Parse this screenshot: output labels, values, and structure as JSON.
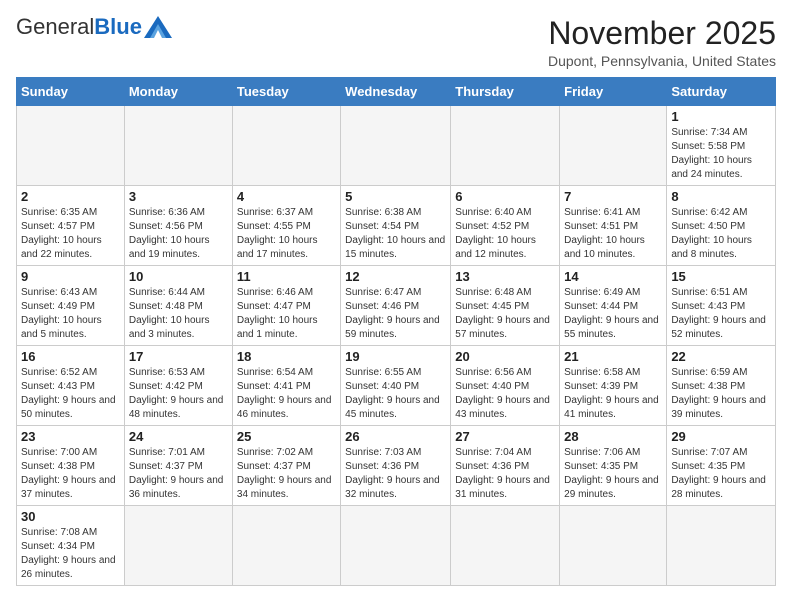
{
  "header": {
    "logo_general": "General",
    "logo_blue": "Blue",
    "logo_sub": "BLUE",
    "month_title": "November 2025",
    "location": "Dupont, Pennsylvania, United States"
  },
  "days_of_week": [
    "Sunday",
    "Monday",
    "Tuesday",
    "Wednesday",
    "Thursday",
    "Friday",
    "Saturday"
  ],
  "weeks": [
    [
      {
        "day": "",
        "info": ""
      },
      {
        "day": "",
        "info": ""
      },
      {
        "day": "",
        "info": ""
      },
      {
        "day": "",
        "info": ""
      },
      {
        "day": "",
        "info": ""
      },
      {
        "day": "",
        "info": ""
      },
      {
        "day": "1",
        "info": "Sunrise: 7:34 AM\nSunset: 5:58 PM\nDaylight: 10 hours and 24 minutes."
      }
    ],
    [
      {
        "day": "2",
        "info": "Sunrise: 6:35 AM\nSunset: 4:57 PM\nDaylight: 10 hours and 22 minutes."
      },
      {
        "day": "3",
        "info": "Sunrise: 6:36 AM\nSunset: 4:56 PM\nDaylight: 10 hours and 19 minutes."
      },
      {
        "day": "4",
        "info": "Sunrise: 6:37 AM\nSunset: 4:55 PM\nDaylight: 10 hours and 17 minutes."
      },
      {
        "day": "5",
        "info": "Sunrise: 6:38 AM\nSunset: 4:54 PM\nDaylight: 10 hours and 15 minutes."
      },
      {
        "day": "6",
        "info": "Sunrise: 6:40 AM\nSunset: 4:52 PM\nDaylight: 10 hours and 12 minutes."
      },
      {
        "day": "7",
        "info": "Sunrise: 6:41 AM\nSunset: 4:51 PM\nDaylight: 10 hours and 10 minutes."
      },
      {
        "day": "8",
        "info": "Sunrise: 6:42 AM\nSunset: 4:50 PM\nDaylight: 10 hours and 8 minutes."
      }
    ],
    [
      {
        "day": "9",
        "info": "Sunrise: 6:43 AM\nSunset: 4:49 PM\nDaylight: 10 hours and 5 minutes."
      },
      {
        "day": "10",
        "info": "Sunrise: 6:44 AM\nSunset: 4:48 PM\nDaylight: 10 hours and 3 minutes."
      },
      {
        "day": "11",
        "info": "Sunrise: 6:46 AM\nSunset: 4:47 PM\nDaylight: 10 hours and 1 minute."
      },
      {
        "day": "12",
        "info": "Sunrise: 6:47 AM\nSunset: 4:46 PM\nDaylight: 9 hours and 59 minutes."
      },
      {
        "day": "13",
        "info": "Sunrise: 6:48 AM\nSunset: 4:45 PM\nDaylight: 9 hours and 57 minutes."
      },
      {
        "day": "14",
        "info": "Sunrise: 6:49 AM\nSunset: 4:44 PM\nDaylight: 9 hours and 55 minutes."
      },
      {
        "day": "15",
        "info": "Sunrise: 6:51 AM\nSunset: 4:43 PM\nDaylight: 9 hours and 52 minutes."
      }
    ],
    [
      {
        "day": "16",
        "info": "Sunrise: 6:52 AM\nSunset: 4:43 PM\nDaylight: 9 hours and 50 minutes."
      },
      {
        "day": "17",
        "info": "Sunrise: 6:53 AM\nSunset: 4:42 PM\nDaylight: 9 hours and 48 minutes."
      },
      {
        "day": "18",
        "info": "Sunrise: 6:54 AM\nSunset: 4:41 PM\nDaylight: 9 hours and 46 minutes."
      },
      {
        "day": "19",
        "info": "Sunrise: 6:55 AM\nSunset: 4:40 PM\nDaylight: 9 hours and 45 minutes."
      },
      {
        "day": "20",
        "info": "Sunrise: 6:56 AM\nSunset: 4:40 PM\nDaylight: 9 hours and 43 minutes."
      },
      {
        "day": "21",
        "info": "Sunrise: 6:58 AM\nSunset: 4:39 PM\nDaylight: 9 hours and 41 minutes."
      },
      {
        "day": "22",
        "info": "Sunrise: 6:59 AM\nSunset: 4:38 PM\nDaylight: 9 hours and 39 minutes."
      }
    ],
    [
      {
        "day": "23",
        "info": "Sunrise: 7:00 AM\nSunset: 4:38 PM\nDaylight: 9 hours and 37 minutes."
      },
      {
        "day": "24",
        "info": "Sunrise: 7:01 AM\nSunset: 4:37 PM\nDaylight: 9 hours and 36 minutes."
      },
      {
        "day": "25",
        "info": "Sunrise: 7:02 AM\nSunset: 4:37 PM\nDaylight: 9 hours and 34 minutes."
      },
      {
        "day": "26",
        "info": "Sunrise: 7:03 AM\nSunset: 4:36 PM\nDaylight: 9 hours and 32 minutes."
      },
      {
        "day": "27",
        "info": "Sunrise: 7:04 AM\nSunset: 4:36 PM\nDaylight: 9 hours and 31 minutes."
      },
      {
        "day": "28",
        "info": "Sunrise: 7:06 AM\nSunset: 4:35 PM\nDaylight: 9 hours and 29 minutes."
      },
      {
        "day": "29",
        "info": "Sunrise: 7:07 AM\nSunset: 4:35 PM\nDaylight: 9 hours and 28 minutes."
      }
    ],
    [
      {
        "day": "30",
        "info": "Sunrise: 7:08 AM\nSunset: 4:34 PM\nDaylight: 9 hours and 26 minutes."
      },
      {
        "day": "",
        "info": ""
      },
      {
        "day": "",
        "info": ""
      },
      {
        "day": "",
        "info": ""
      },
      {
        "day": "",
        "info": ""
      },
      {
        "day": "",
        "info": ""
      },
      {
        "day": "",
        "info": ""
      }
    ]
  ]
}
